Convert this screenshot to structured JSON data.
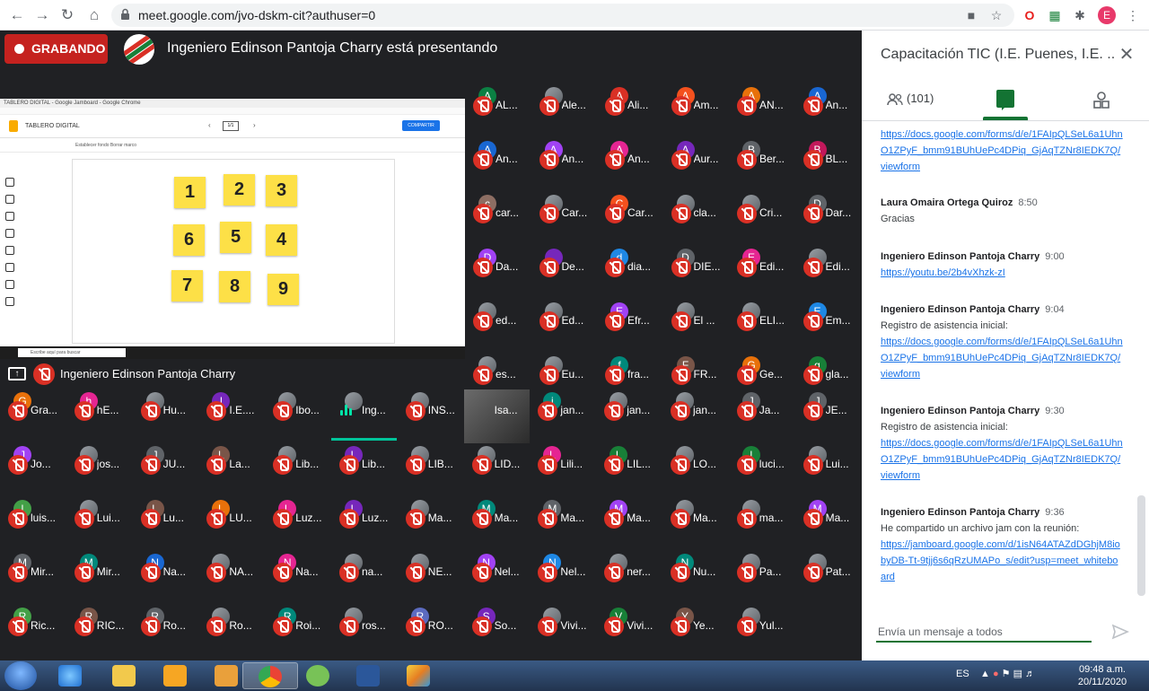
{
  "browser": {
    "url": "meet.google.com/jvo-dskm-cit?authuser=0",
    "profile_letter": "E"
  },
  "meet": {
    "recording_label": "GRABANDO",
    "presenting_text": "Ingeniero Edinson Pantoja Charry está presentando",
    "presenter_name": "Ingeniero Edinson Pantoja Charry",
    "shared_screen": {
      "window_title": "TABLERO DIGITAL - Google Jamboard - Google Chrome",
      "board_title": "TABLERO DIGITAL",
      "frame_indicator": "1/1",
      "share_button": "COMPARTIR",
      "toolbar_text": "Establecer fondo     Borrar marco",
      "taskbar_search": "Escribe aquí para buscar",
      "stickies": [
        "1",
        "2",
        "3",
        "6",
        "5",
        "4",
        "7",
        "8",
        "9"
      ]
    },
    "tiles_right": [
      {
        "l": "A",
        "n": "AL...",
        "c": "#0b8043"
      },
      {
        "l": "",
        "n": "Ale...",
        "c": ""
      },
      {
        "l": "A",
        "n": "Ali...",
        "c": "#d93025"
      },
      {
        "l": "A",
        "n": "Am...",
        "c": "#f4511e"
      },
      {
        "l": "A",
        "n": "AN...",
        "c": "#e8710a"
      },
      {
        "l": "A",
        "n": "An...",
        "c": "#1967d2"
      },
      {
        "l": "A",
        "n": "An...",
        "c": "#1967d2"
      },
      {
        "l": "A",
        "n": "An...",
        "c": "#a142f4"
      },
      {
        "l": "A",
        "n": "An...",
        "c": "#e52592"
      },
      {
        "l": "A",
        "n": "Aur...",
        "c": "#7627bb"
      },
      {
        "l": "B",
        "n": "Ber...",
        "c": "#5f6368"
      },
      {
        "l": "B",
        "n": "BL...",
        "c": "#c2185b"
      },
      {
        "l": "c",
        "n": "car...",
        "c": "#8d6e63"
      },
      {
        "l": "",
        "n": "Car...",
        "c": ""
      },
      {
        "l": "C",
        "n": "Car...",
        "c": "#f4511e"
      },
      {
        "l": "",
        "n": "cla...",
        "c": ""
      },
      {
        "l": "",
        "n": "Cri...",
        "c": ""
      },
      {
        "l": "D",
        "n": "Dar...",
        "c": "#5f6368"
      },
      {
        "l": "D",
        "n": "Da...",
        "c": "#a142f4"
      },
      {
        "l": "",
        "n": "De...",
        "c": "#7627bb"
      },
      {
        "l": "d",
        "n": "dia...",
        "c": "#1e88e5"
      },
      {
        "l": "D",
        "n": "DIE...",
        "c": "#5f6368"
      },
      {
        "l": "E",
        "n": "Edi...",
        "c": "#e52592"
      },
      {
        "l": "",
        "n": "Edi...",
        "c": ""
      },
      {
        "l": "",
        "n": "ed...",
        "c": ""
      },
      {
        "l": "",
        "n": "Ed...",
        "c": ""
      },
      {
        "l": "E",
        "n": "Efr...",
        "c": "#a142f4"
      },
      {
        "l": "",
        "n": "El ...",
        "c": ""
      },
      {
        "l": "",
        "n": "ELI...",
        "c": ""
      },
      {
        "l": "E",
        "n": "Em...",
        "c": "#1e88e5"
      },
      {
        "l": "",
        "n": "es...",
        "c": ""
      },
      {
        "l": "",
        "n": "Eu...",
        "c": ""
      },
      {
        "l": "f",
        "n": "fra...",
        "c": "#00897b"
      },
      {
        "l": "F",
        "n": "FR...",
        "c": "#795548"
      },
      {
        "l": "G",
        "n": "Ge...",
        "c": "#e8710a"
      },
      {
        "l": "g",
        "n": "gla...",
        "c": "#188038"
      }
    ],
    "tiles_bottom": [
      {
        "l": "G",
        "n": "Gra...",
        "c": "#e8710a"
      },
      {
        "l": "h",
        "n": "hE...",
        "c": "#e52592"
      },
      {
        "l": "",
        "n": "Hu...",
        "c": ""
      },
      {
        "l": "I",
        "n": "I.E....",
        "c": "#7627bb"
      },
      {
        "l": "",
        "n": "Ibo...",
        "c": ""
      },
      {
        "l": "",
        "n": "Ing...",
        "c": "",
        "speaking": true
      },
      {
        "l": "",
        "n": "INS...",
        "c": ""
      },
      {
        "l": "",
        "n": "Isa...",
        "c": "",
        "video": true
      },
      {
        "l": "j",
        "n": "jan...",
        "c": "#00897b"
      },
      {
        "l": "",
        "n": "jan...",
        "c": ""
      },
      {
        "l": "",
        "n": "jan...",
        "c": ""
      },
      {
        "l": "J",
        "n": "Ja...",
        "c": "#5f6368"
      },
      {
        "l": "J",
        "n": "JE...",
        "c": "#5f6368"
      },
      {
        "l": "J",
        "n": "Jo...",
        "c": "#a142f4"
      },
      {
        "l": "",
        "n": "jos...",
        "c": ""
      },
      {
        "l": "J",
        "n": "JU...",
        "c": "#5f6368"
      },
      {
        "l": "L",
        "n": "La...",
        "c": "#795548"
      },
      {
        "l": "",
        "n": "Lib...",
        "c": ""
      },
      {
        "l": "L",
        "n": "Lib...",
        "c": "#7627bb"
      },
      {
        "l": "",
        "n": "LIB...",
        "c": ""
      },
      {
        "l": "",
        "n": "LID...",
        "c": ""
      },
      {
        "l": "L",
        "n": "Lili...",
        "c": "#e52592"
      },
      {
        "l": "L",
        "n": "LIL...",
        "c": "#188038"
      },
      {
        "l": "",
        "n": "LO...",
        "c": ""
      },
      {
        "l": "l",
        "n": "luci...",
        "c": "#188038"
      },
      {
        "l": "",
        "n": "Lui...",
        "c": ""
      },
      {
        "l": "l",
        "n": "luis...",
        "c": "#43a047"
      },
      {
        "l": "",
        "n": "Lui...",
        "c": ""
      },
      {
        "l": "L",
        "n": "Lu...",
        "c": "#795548"
      },
      {
        "l": "L",
        "n": "LU...",
        "c": "#e8710a"
      },
      {
        "l": "L",
        "n": "Luz...",
        "c": "#e52592"
      },
      {
        "l": "L",
        "n": "Luz...",
        "c": "#7627bb"
      },
      {
        "l": "",
        "n": "Ma...",
        "c": ""
      },
      {
        "l": "M",
        "n": "Ma...",
        "c": "#00897b"
      },
      {
        "l": "M",
        "n": "Ma...",
        "c": "#5f6368"
      },
      {
        "l": "M",
        "n": "Ma...",
        "c": "#a142f4"
      },
      {
        "l": "",
        "n": "Ma...",
        "c": ""
      },
      {
        "l": "",
        "n": "ma...",
        "c": ""
      },
      {
        "l": "M",
        "n": "Ma...",
        "c": "#a142f4"
      },
      {
        "l": "M",
        "n": "Mir...",
        "c": "#5f6368"
      },
      {
        "l": "M",
        "n": "Mir...",
        "c": "#00897b"
      },
      {
        "l": "N",
        "n": "Na...",
        "c": "#1967d2"
      },
      {
        "l": "",
        "n": "NA...",
        "c": ""
      },
      {
        "l": "N",
        "n": "Na...",
        "c": "#e52592"
      },
      {
        "l": "",
        "n": "na...",
        "c": ""
      },
      {
        "l": "",
        "n": "NE...",
        "c": ""
      },
      {
        "l": "N",
        "n": "Nel...",
        "c": "#a142f4"
      },
      {
        "l": "N",
        "n": "Nel...",
        "c": "#1e88e5"
      },
      {
        "l": "",
        "n": "ner...",
        "c": ""
      },
      {
        "l": "N",
        "n": "Nu...",
        "c": "#00897b"
      },
      {
        "l": "",
        "n": "Pa...",
        "c": ""
      },
      {
        "l": "",
        "n": "Pat...",
        "c": ""
      },
      {
        "l": "R",
        "n": "Ric...",
        "c": "#43a047"
      },
      {
        "l": "R",
        "n": "RIC...",
        "c": "#795548"
      },
      {
        "l": "R",
        "n": "Ro...",
        "c": "#5f6368"
      },
      {
        "l": "",
        "n": "Ro...",
        "c": ""
      },
      {
        "l": "R",
        "n": "Roi...",
        "c": "#00897b"
      },
      {
        "l": "",
        "n": "ros...",
        "c": ""
      },
      {
        "l": "R",
        "n": "RO...",
        "c": "#5c6bc0"
      },
      {
        "l": "S",
        "n": "So...",
        "c": "#7627bb"
      },
      {
        "l": "",
        "n": "Vivi...",
        "c": ""
      },
      {
        "l": "V",
        "n": "Vivi...",
        "c": "#188038"
      },
      {
        "l": "Y",
        "n": "Ye...",
        "c": "#795548"
      },
      {
        "l": "",
        "n": "Yul...",
        "c": ""
      }
    ]
  },
  "panel": {
    "title": "Capacitación TIC (I.E. Puenes, I.E. ...",
    "people_count": "(101)",
    "input_placeholder": "Envía un mensaje a todos",
    "messages": [
      {
        "who": "",
        "time": "",
        "text": "",
        "link": "https://docs.google.com/forms/d/e/1FAIpQLSeL6a1UhnO1ZPyF_bmm91BUhUePc4DPiq_GjAqTZNr8IEDK7Q/viewform"
      },
      {
        "who": "Laura Omaira Ortega Quiroz",
        "time": "8:50",
        "text": "Gracias",
        "link": ""
      },
      {
        "who": "Ingeniero Edinson Pantoja Charry",
        "time": "9:00",
        "text": "",
        "link": "https://youtu.be/2b4vXhzk-zI"
      },
      {
        "who": "Ingeniero Edinson Pantoja Charry",
        "time": "9:04",
        "text": "Registro de asistencia inicial:",
        "link": "https://docs.google.com/forms/d/e/1FAIpQLSeL6a1UhnO1ZPyF_bmm91BUhUePc4DPiq_GjAqTZNr8IEDK7Q/viewform"
      },
      {
        "who": "Ingeniero Edinson Pantoja Charry",
        "time": "9:30",
        "text": "Registro de asistencia inicial:",
        "link": "https://docs.google.com/forms/d/e/1FAIpQLSeL6a1UhnO1ZPyF_bmm91BUhUePc4DPiq_GjAqTZNr8IEDK7Q/viewform"
      },
      {
        "who": "Ingeniero Edinson Pantoja Charry",
        "time": "9:36",
        "text": "He compartido un archivo jam con la reunión:",
        "link": "https://jamboard.google.com/d/1isN64ATAZdDGhjM8iobyDB-Tt-9tjj6s6qRzUMAPo_s/edit?usp=meet_whiteboard"
      }
    ]
  },
  "taskbar": {
    "lang": "ES",
    "time": "09:48 a.m.",
    "date": "20/11/2020"
  },
  "colors": {
    "meet_bg": "#202124",
    "recording_red": "#c5221f",
    "mic_off_red": "#d93025",
    "chat_green": "#137333",
    "link_blue": "#1a73e8"
  }
}
